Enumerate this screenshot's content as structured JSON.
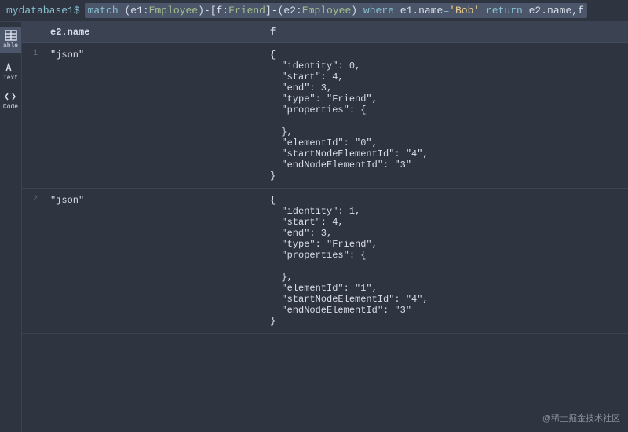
{
  "prompt_prefix": "mydatabase1$",
  "query": {
    "match": "match",
    "lp1": "(",
    "e1": "e1",
    "colon1": ":",
    "emp1": "Employee",
    "rp1": ")",
    "dash1": "-",
    "lb1": "[",
    "f": "f",
    "colon2": ":",
    "friend": "Friend",
    "rb1": "]",
    "dash2": "-",
    "lp2": "(",
    "e2": "e2",
    "colon3": ":",
    "emp2": "Employee",
    "rp2": ")",
    "where": "where",
    "e1b": "e1",
    "dot1": ".",
    "name": "name",
    "eq": "=",
    "str": "'Bob'",
    "return": "return",
    "e2b": "e2",
    "dot2": ".",
    "name2": "name",
    "comma": ",",
    "fret": "f"
  },
  "sidebar": {
    "table": "able",
    "text": "Text",
    "code": "Code"
  },
  "columns": {
    "col1": "e2.name",
    "col2": "f"
  },
  "rows": [
    {
      "num": "1",
      "name": "\"json\"",
      "json": "{\n  \"identity\": 0,\n  \"start\": 4,\n  \"end\": 3,\n  \"type\": \"Friend\",\n  \"properties\": {\n\n  },\n  \"elementId\": \"0\",\n  \"startNodeElementId\": \"4\",\n  \"endNodeElementId\": \"3\"\n}"
    },
    {
      "num": "2",
      "name": "\"json\"",
      "json": "{\n  \"identity\": 1,\n  \"start\": 4,\n  \"end\": 3,\n  \"type\": \"Friend\",\n  \"properties\": {\n\n  },\n  \"elementId\": \"1\",\n  \"startNodeElementId\": \"4\",\n  \"endNodeElementId\": \"3\"\n}"
    }
  ],
  "watermark": "@稀土掘金技术社区"
}
